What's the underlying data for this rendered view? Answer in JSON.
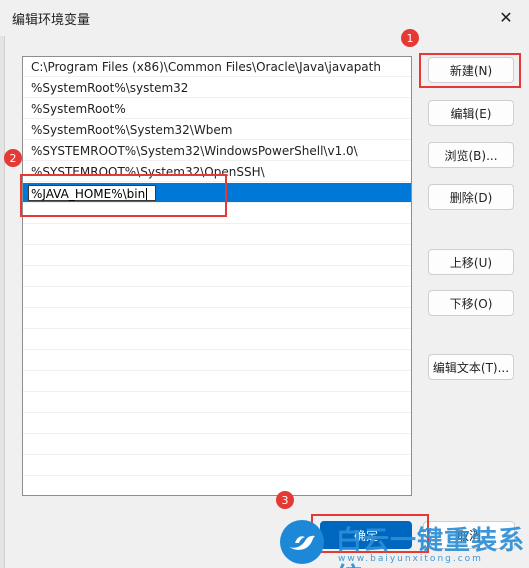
{
  "window": {
    "title": "编辑环境变量",
    "close_glyph": "✕"
  },
  "list": {
    "items": [
      "C:\\Program Files (x86)\\Common Files\\Oracle\\Java\\javapath",
      "%SystemRoot%\\system32",
      "%SystemRoot%",
      "%SystemRoot%\\System32\\Wbem",
      "%SYSTEMROOT%\\System32\\WindowsPowerShell\\v1.0\\",
      "%SYSTEMROOT%\\System32\\OpenSSH\\"
    ],
    "editing_value": "%JAVA_HOME%\\bin"
  },
  "buttons": {
    "new": "新建(N)",
    "edit": "编辑(E)",
    "browse": "浏览(B)...",
    "delete": "删除(D)",
    "move_up": "上移(U)",
    "move_down": "下移(O)",
    "edit_text": "编辑文本(T)...",
    "ok": "确定",
    "cancel": "取消"
  },
  "annotations": {
    "badge1": "1",
    "badge2": "2",
    "badge3": "3",
    "color": "#e53935"
  },
  "watermark": {
    "text": "白云一键重装系统",
    "url": "www.baiyunxitong.com",
    "icon": "bird-icon",
    "color": "#2c8fd6"
  },
  "colors": {
    "selection": "#0078d7",
    "primary": "#0067c0"
  }
}
